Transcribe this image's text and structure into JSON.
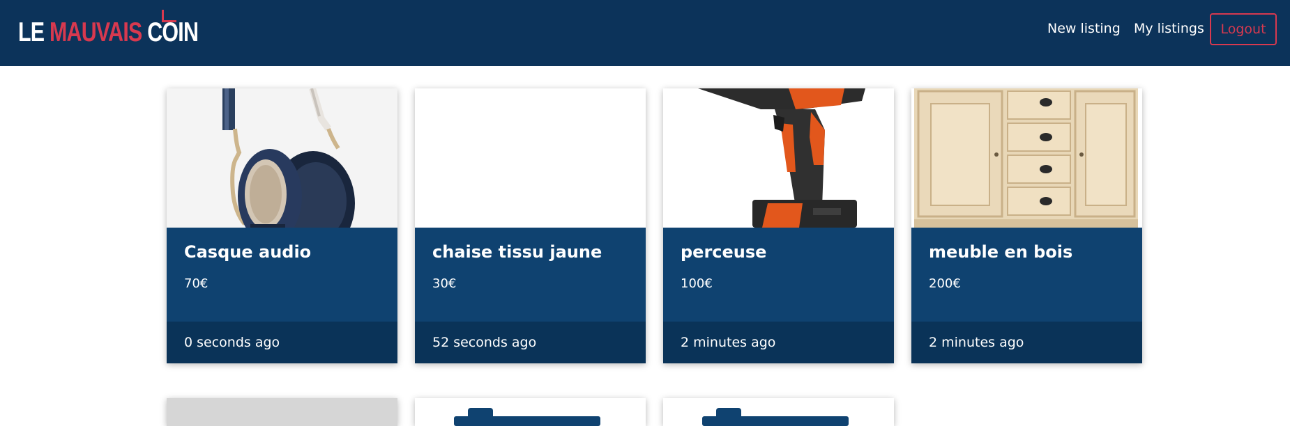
{
  "header": {
    "logo": {
      "part1": "LE ",
      "part2": "MAUVAIS",
      "part3": " COIN"
    },
    "nav": {
      "new_listing": "New listing",
      "my_listings": "My listings",
      "logout": "Logout"
    }
  },
  "listings": [
    {
      "title": "Casque audio",
      "price": "70€",
      "time": "0 seconds ago",
      "image": "headphones"
    },
    {
      "title": "chaise tissu jaune",
      "price": "30€",
      "time": "52 seconds ago",
      "image": "blank"
    },
    {
      "title": "perceuse",
      "price": "100€",
      "time": "2 minutes ago",
      "image": "drill"
    },
    {
      "title": "meuble en bois",
      "price": "200€",
      "time": "2 minutes ago",
      "image": "wooden-cabinet"
    }
  ],
  "colors": {
    "navbar": "#0c335a",
    "accent": "#d8394f",
    "card_body": "#0f4270",
    "card_footer": "#0a3358"
  }
}
